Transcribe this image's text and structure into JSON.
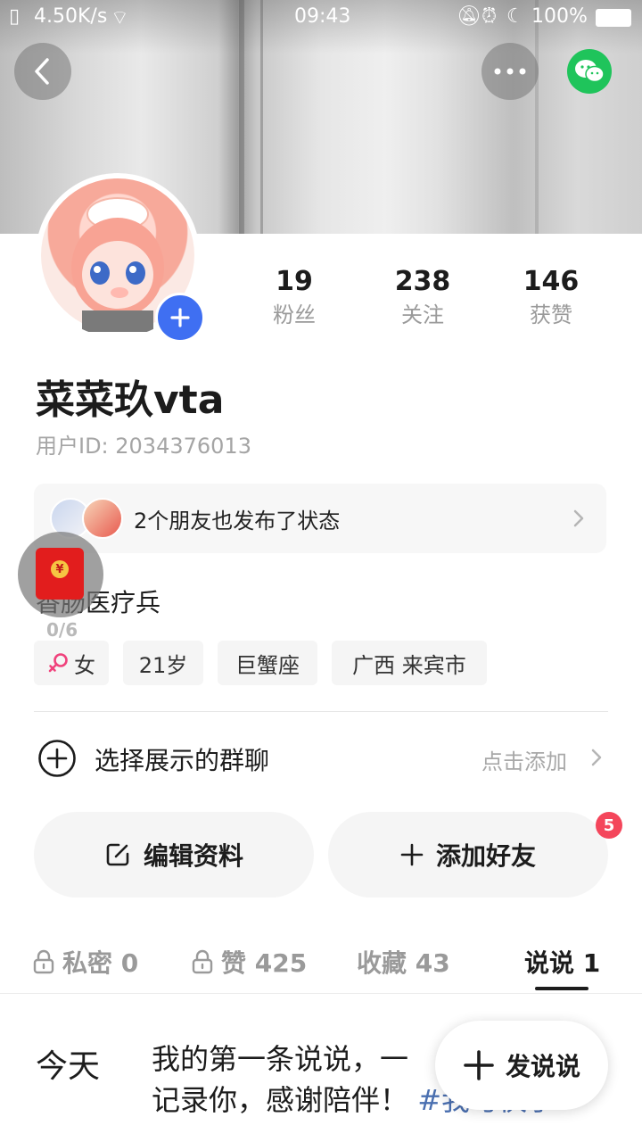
{
  "status_bar": {
    "speed": "4.50K/s",
    "time": "09:43",
    "battery": "100%"
  },
  "profile": {
    "stats": [
      {
        "value": "19",
        "label": "粉丝"
      },
      {
        "value": "238",
        "label": "关注"
      },
      {
        "value": "146",
        "label": "获赞"
      }
    ],
    "nickname": "菜菜玖vta",
    "user_id": "用户ID: 2034376013",
    "friends_status": "2个朋友也发布了状态",
    "bio": "香肠医疗兵",
    "redpacket_counter": "0/6",
    "tags": {
      "gender": "女",
      "age": "21岁",
      "zodiac": "巨蟹座",
      "location": "广西 来宾市"
    }
  },
  "group_row": {
    "label": "选择展示的群聊",
    "action": "点击添加"
  },
  "buttons": {
    "edit": "编辑资料",
    "add_friend": "添加好友",
    "notification_count": "5"
  },
  "tabs": [
    {
      "label": "私密 0",
      "locked": true
    },
    {
      "label": "赞 425",
      "locked": true
    },
    {
      "label": "收藏 43",
      "locked": false
    },
    {
      "label": "说说 1",
      "locked": false,
      "active": true
    }
  ],
  "post": {
    "date": "今天",
    "text": "我的第一条说说，一",
    "text_line2": "记录你，感谢陪伴！",
    "hashtag": "#我与快手"
  },
  "fab": {
    "label": "发说说"
  },
  "colors": {
    "accent_blue": "#3f6ff2",
    "wechat_green": "#1fc45b",
    "badge_red": "#f4465b",
    "redpacket": "#e21d1d"
  }
}
